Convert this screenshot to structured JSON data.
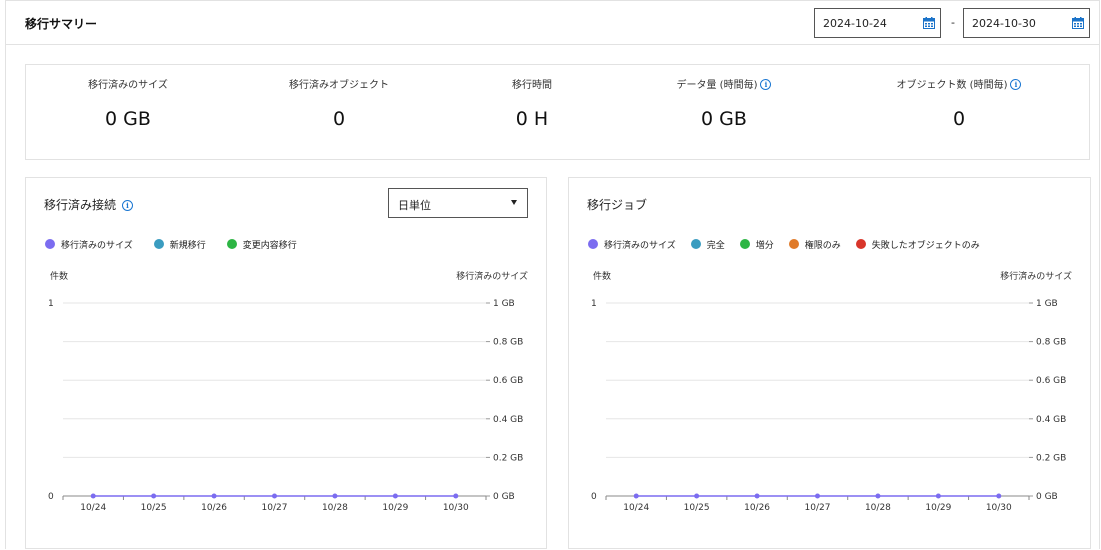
{
  "header": {
    "title": "移行サマリー"
  },
  "date_range": {
    "start": "2024-10-24",
    "end": "2024-10-30",
    "separator": "-"
  },
  "summary": [
    {
      "label": "移行済みのサイズ",
      "value": "0 GB",
      "info": false
    },
    {
      "label": "移行済みオブジェクト",
      "value": "0",
      "info": false
    },
    {
      "label": "移行時間",
      "value": "0 H",
      "info": false
    },
    {
      "label": "データ量 (時間毎)",
      "value": "0 GB",
      "info": true
    },
    {
      "label": "オブジェクト数 (時間毎)",
      "value": "0",
      "info": true
    }
  ],
  "panels": {
    "connections": {
      "title": "移行済み接続",
      "select_value": "日単位",
      "left_axis_title": "件数",
      "right_axis_title": "移行済みのサイズ",
      "legend": [
        {
          "label": "移行済みのサイズ",
          "color": "#7b6cf0"
        },
        {
          "label": "新規移行",
          "color": "#3a9cc0"
        },
        {
          "label": "変更内容移行",
          "color": "#2db544"
        }
      ]
    },
    "jobs": {
      "title": "移行ジョブ",
      "left_axis_title": "件数",
      "right_axis_title": "移行済みのサイズ",
      "legend": [
        {
          "label": "移行済みのサイズ",
          "color": "#7b6cf0"
        },
        {
          "label": "完全",
          "color": "#3a9cc0"
        },
        {
          "label": "増分",
          "color": "#2db544"
        },
        {
          "label": "権限のみ",
          "color": "#e07a28"
        },
        {
          "label": "失敗したオブジェクトのみ",
          "color": "#d8352a"
        }
      ]
    }
  },
  "chart_data": [
    {
      "type": "line",
      "categories": [
        "10/24",
        "10/25",
        "10/26",
        "10/27",
        "10/28",
        "10/29",
        "10/30"
      ],
      "left_axis": {
        "label": "件数",
        "ticks": [
          "0",
          "1"
        ],
        "ylim": [
          0,
          1
        ]
      },
      "right_axis": {
        "label": "移行済みのサイズ",
        "ticks": [
          "0 GB",
          "0.2 GB",
          "0.4 GB",
          "0.6 GB",
          "0.8 GB",
          "1 GB"
        ],
        "ylim": [
          0,
          1
        ]
      },
      "series": [
        {
          "name": "移行済みのサイズ",
          "values": [
            0,
            0,
            0,
            0,
            0,
            0,
            0
          ],
          "color": "#7b6cf0"
        }
      ]
    },
    {
      "type": "line",
      "categories": [
        "10/24",
        "10/25",
        "10/26",
        "10/27",
        "10/28",
        "10/29",
        "10/30"
      ],
      "left_axis": {
        "label": "件数",
        "ticks": [
          "0",
          "1"
        ],
        "ylim": [
          0,
          1
        ]
      },
      "right_axis": {
        "label": "移行済みのサイズ",
        "ticks": [
          "0 GB",
          "0.2 GB",
          "0.4 GB",
          "0.6 GB",
          "0.8 GB",
          "1 GB"
        ],
        "ylim": [
          0,
          1
        ]
      },
      "series": [
        {
          "name": "移行済みのサイズ",
          "values": [
            0,
            0,
            0,
            0,
            0,
            0,
            0
          ],
          "color": "#7b6cf0"
        }
      ]
    }
  ]
}
